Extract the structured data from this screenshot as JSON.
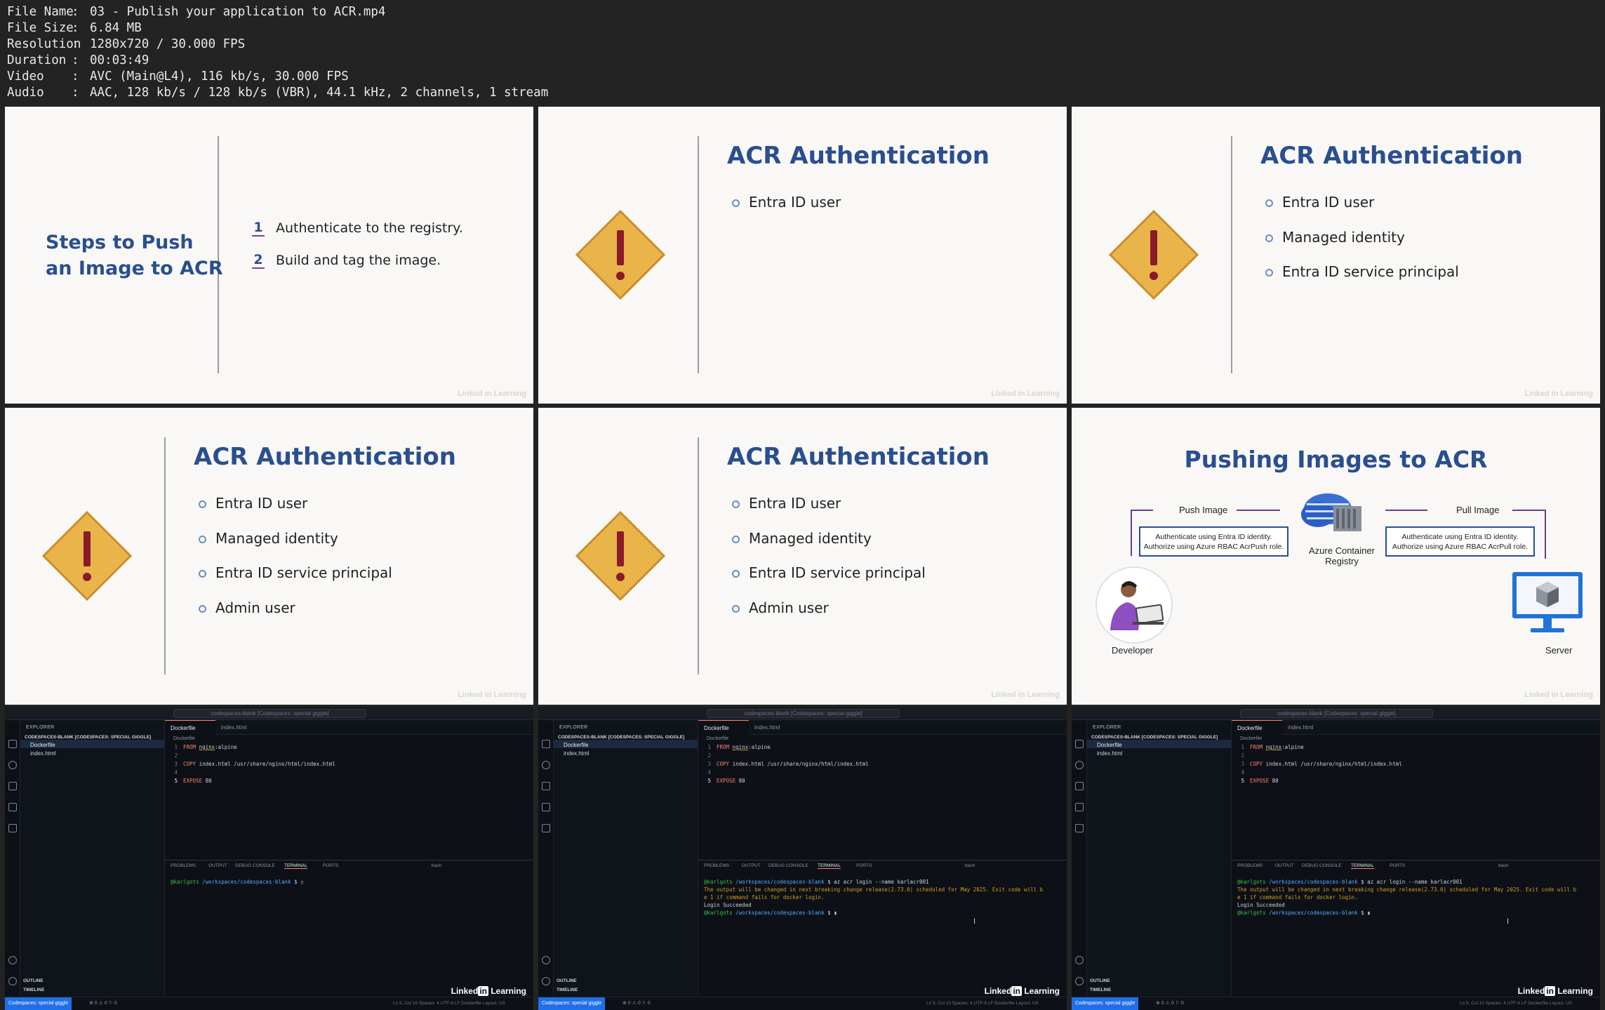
{
  "info": [
    {
      "key": "File Name",
      "value": "03 - Publish your application to ACR.mp4"
    },
    {
      "key": "File Size",
      "value": "6.84 MB"
    },
    {
      "key": "Resolution",
      "value": "1280x720 / 30.000 FPS"
    },
    {
      "key": "Duration",
      "value": "00:03:49"
    },
    {
      "key": "Video",
      "value": "AVC (Main@L4), 116 kb/s, 30.000 FPS"
    },
    {
      "key": "Audio",
      "value": "AAC, 128 kb/s / 128 kb/s (VBR), 44.1 kHz, 2 channels, 1 stream"
    }
  ],
  "steps": {
    "title_line1": "Steps to Push",
    "title_line2": "an Image to ACR",
    "items": [
      {
        "num": "1",
        "text": "Authenticate to the registry."
      },
      {
        "num": "2",
        "text": "Build and tag the image."
      }
    ]
  },
  "acr": {
    "title": "ACR Authentication",
    "bullets": [
      "Entra ID user",
      "Managed identity",
      "Entra ID service principal",
      "Admin user"
    ]
  },
  "watermark": "Linked in Learning",
  "pushing": {
    "title": "Pushing Images to ACR",
    "push_label": "Push Image",
    "pull_label": "Pull Image",
    "push_note": [
      "Authenticate using Entra ID identity.",
      "Authorize using Azure RBAC AcrPush role."
    ],
    "pull_note": [
      "Authenticate using Entra ID identity.",
      "Authorize using Azure RBAC AcrPull role."
    ],
    "registry_label": [
      "Azure Container",
      "Registry"
    ],
    "developer_label": "Developer",
    "server_label": "Server"
  },
  "vscode": {
    "search": "codespaces-blank [Codespaces: special giggle]",
    "explorer_title": "EXPLORER",
    "workspace": "CODESPACES-BLANK [CODESPACES: SPECIAL GIGGLE]",
    "files": [
      "Dockerfile",
      "index.html"
    ],
    "outline": "OUTLINE",
    "timeline": "TIMELINE",
    "tab_active": "Dockerfile",
    "tab_other": "index.html",
    "breadcrumb": "Dockerfile",
    "code": {
      "l1_kw": "FROM",
      "l1_img": "nginx",
      "l1_tag": ":alpine",
      "l3_kw": "COPY",
      "l3_args": "index.html /usr/share/nginx/html/index.html",
      "l5_kw": "EXPOSE",
      "l5_args": "80"
    },
    "panel_tabs": [
      "PROBLEMS",
      "OUTPUT",
      "DEBUG CONSOLE",
      "TERMINAL",
      "PORTS"
    ],
    "shell": "bash",
    "user": "@karlgots",
    "path": "/workspaces/codespaces-blank",
    "cmd": "$ az acr login --name karlacr001",
    "warn1": "The output will be changed in next breaking change release(2.73.0) scheduled for May 2025. Exit code will b",
    "warn2": "e 1 if command fails for docker login.",
    "login": "Login Succeeded",
    "prompt": "$",
    "remote": "Codespaces: special giggle",
    "status_left": "⊗ 0 ⚠ 0   ⚐ 0",
    "status_right": "Ln 5, Col 10   Spaces: 4   UTF-8   LF   Dockerfile   Layout: US",
    "brand": "Linked",
    "brand_in": "in",
    "brand_tail": " Learning"
  }
}
